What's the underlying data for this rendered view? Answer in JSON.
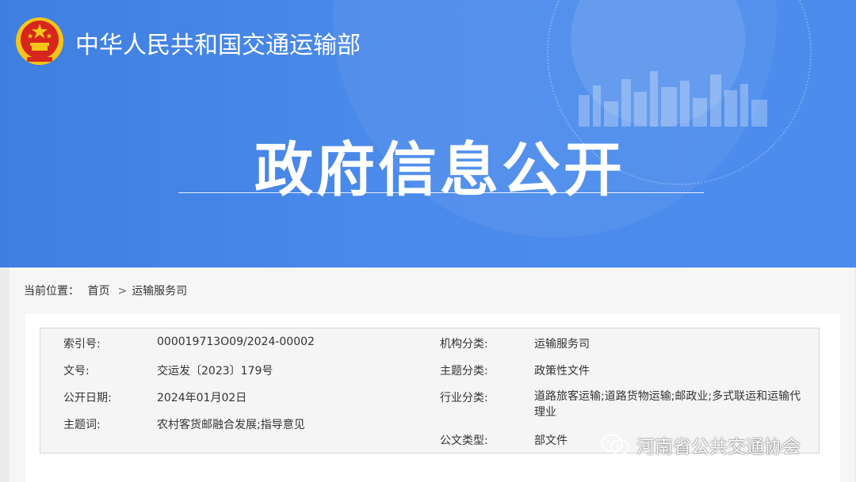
{
  "header": {
    "ministry_name": "中华人民共和国交通运输部",
    "section_title": "政府信息公开"
  },
  "breadcrumb": {
    "prefix": "当前位置：",
    "items": [
      "首页",
      "运输服务司"
    ],
    "separator": ">"
  },
  "metadata": {
    "left": [
      {
        "label": "索引号:",
        "value": "000019713O09/2024-00002"
      },
      {
        "label": "文号:",
        "value": "交运发〔2023〕179号"
      },
      {
        "label": "公开日期:",
        "value": "2024年01月02日"
      },
      {
        "label": "主题词:",
        "value": "农村客货邮融合发展;指导意见"
      }
    ],
    "right": [
      {
        "label": "机构分类:",
        "value": "运输服务司"
      },
      {
        "label": "主题分类:",
        "value": "政策性文件"
      },
      {
        "label": "行业分类:",
        "value": "道路旅客运输;道路货物运输;邮政业;多式联运和运输代理业"
      },
      {
        "label": "公文类型:",
        "value": "部文件"
      }
    ]
  },
  "watermark": {
    "text": "河南省公共交通协会",
    "icon": "wechat-icon"
  },
  "colors": {
    "banner_blue": "#4a8aea",
    "emblem_red": "#d7261e",
    "emblem_gold": "#f5c518"
  }
}
